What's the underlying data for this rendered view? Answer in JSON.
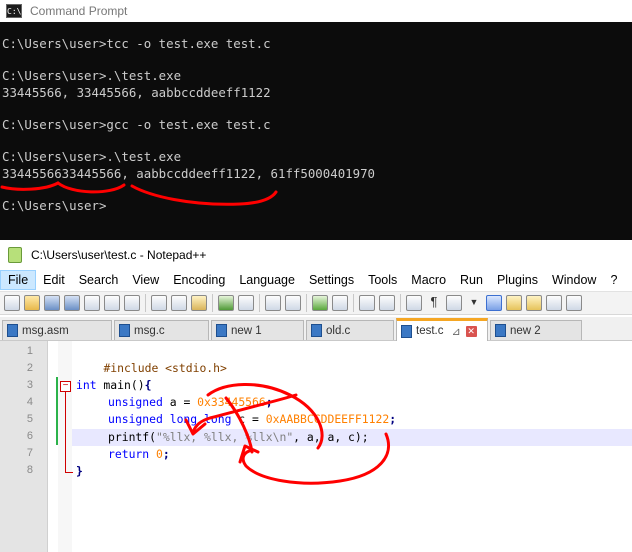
{
  "cmd": {
    "title": "Command Prompt",
    "icon": "C:\\",
    "lines": [
      "C:\\Users\\user>tcc -o test.exe test.c",
      "",
      "C:\\Users\\user>.\\test.exe",
      "33445566, 33445566, aabbccddeeff1122",
      "",
      "C:\\Users\\user>gcc -o test.exe test.c",
      "",
      "C:\\Users\\user>.\\test.exe",
      "3344556633445566, aabbccddeeff1122, 61ff5000401970",
      "",
      "C:\\Users\\user>"
    ]
  },
  "npp": {
    "title": "C:\\Users\\user\\test.c - Notepad++",
    "menu": [
      "File",
      "Edit",
      "Search",
      "View",
      "Encoding",
      "Language",
      "Settings",
      "Tools",
      "Macro",
      "Run",
      "Plugins",
      "Window",
      "?"
    ],
    "tabs": [
      "msg.asm",
      "msg.c",
      "new 1",
      "old.c",
      "test.c",
      "new 2"
    ],
    "active_tab_close": "✕",
    "active_tab_pin": "⊿",
    "line_numbers": [
      "1",
      "2",
      "3",
      "4",
      "5",
      "6",
      "7",
      "8"
    ],
    "code": {
      "l1_pre": "#include <stdio.h>",
      "l3_kw": "int",
      "l3_rest": " main()",
      "l3_brace": "{",
      "l4_kw": "unsigned",
      "l4_rest": " a = ",
      "l4_num": "0x33445566",
      "l4_semi": ";",
      "l5_kw": "unsigned long long",
      "l5_rest": " c = ",
      "l5_num": "0xAABBCCDDEEFF1122",
      "l5_semi": ";",
      "l6_fn": "printf(",
      "l6_str": "\"%llx, %llx, %llx\\n\"",
      "l6_args": ", a, a, c);",
      "l7_kw": "return",
      "l7_num": " 0",
      "l7_semi": ";",
      "l8_brace": "}"
    }
  },
  "colors": {
    "cmd_bg": "#0c0c0c",
    "cmd_text": "#cccccc",
    "annotation": "#ff0000",
    "keyword": "#0000ff",
    "number": "#ff8000",
    "string": "#808080",
    "active_tab_accent": "#f5a623"
  }
}
